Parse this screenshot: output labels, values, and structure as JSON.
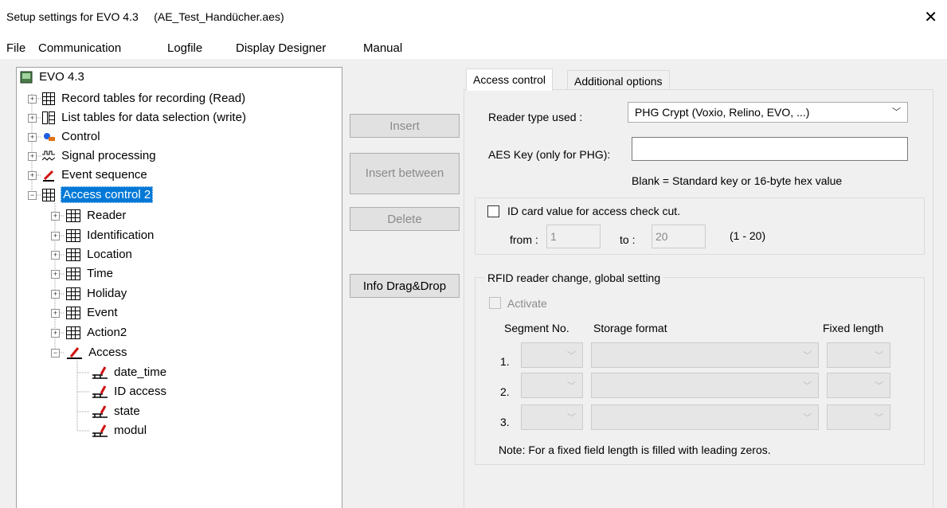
{
  "window": {
    "title": "Setup settings for EVO 4.3     (AE_Test_Handücher.aes)"
  },
  "menu": [
    "File",
    "Communication",
    "Logfile",
    "Display Designer",
    "Manual"
  ],
  "tree": {
    "root": "EVO 4.3",
    "items": [
      "Record tables for recording (Read)",
      "List tables for data selection (write)",
      "Control",
      "Signal processing",
      "Event sequence",
      "Access control 2"
    ],
    "children": [
      "Reader",
      "Identification",
      "Location",
      "Time",
      "Holiday",
      "Event",
      "Action2",
      "Access"
    ],
    "access_children": [
      "date_time",
      "ID access",
      "state",
      "modul"
    ]
  },
  "buttons": {
    "insert": "Insert",
    "insert_between": "Insert between",
    "delete": "Delete",
    "info": "Info Drag&Drop"
  },
  "tabs": {
    "access_control": "Access control",
    "additional": "Additional options"
  },
  "reader": {
    "label": "Reader type used :",
    "value": "PHG Crypt (Voxio, Relino, EVO, ...)"
  },
  "aes": {
    "label": "AES Key (only for PHG):",
    "value": "",
    "hint": "Blank = Standard key or 16-byte hex value"
  },
  "idcard": {
    "label": "ID card value for access check cut.",
    "from_label": "from :",
    "from_value": "1",
    "to_label": "to :",
    "to_value": "20",
    "range": "(1 - 20)"
  },
  "rfid": {
    "title": "RFID reader change, global setting",
    "activate": "Activate",
    "col_segment": "Segment No.",
    "col_format": "Storage format",
    "col_fixed": "Fixed length",
    "rows": [
      "1.",
      "2.",
      "3."
    ],
    "note": "Note: For a fixed field length is filled with leading zeros."
  },
  "colors": {
    "selection": "#0078d7",
    "accent_red": "#d01010"
  }
}
